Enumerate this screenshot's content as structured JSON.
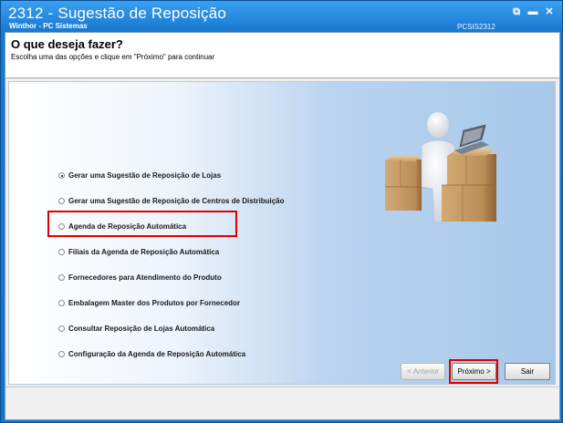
{
  "window": {
    "title": "2312 - Sugestão de Reposição",
    "subtitle": "Winthor - PC Sistemas",
    "code": "PCSIS2312",
    "controls": {
      "restore": "⧉",
      "minimize": "▬",
      "close": "✕"
    }
  },
  "header": {
    "heading": "O que deseja fazer?",
    "instruction": "Escolha uma das opções e clique em \"Próximo\" para continuar"
  },
  "options": [
    {
      "label": "Gerar uma Sugestão de Reposição de Lojas",
      "selected": true
    },
    {
      "label": "Gerar uma Sugestão de Reposição de Centros de Distribuição",
      "selected": false
    },
    {
      "label": "Agenda de Reposição Automática",
      "selected": false
    },
    {
      "label": "Filiais da Agenda de Reposição Automática",
      "selected": false
    },
    {
      "label": "Fornecedores para Atendimento do Produto",
      "selected": false
    },
    {
      "label": "Embalagem Master dos Produtos por Fornecedor",
      "selected": false
    },
    {
      "label": "Consultar Reposição de Lojas Automática",
      "selected": false
    },
    {
      "label": "Configuração da Agenda de Reposição Automática",
      "selected": false
    }
  ],
  "buttons": {
    "previous": "< Anterior",
    "next": "Próximo >",
    "exit": "Sair"
  },
  "colors": {
    "highlight": "#e00000",
    "titlebar": "#1878cf"
  },
  "illustration_icon": "person-with-boxes-and-laptop-icon"
}
